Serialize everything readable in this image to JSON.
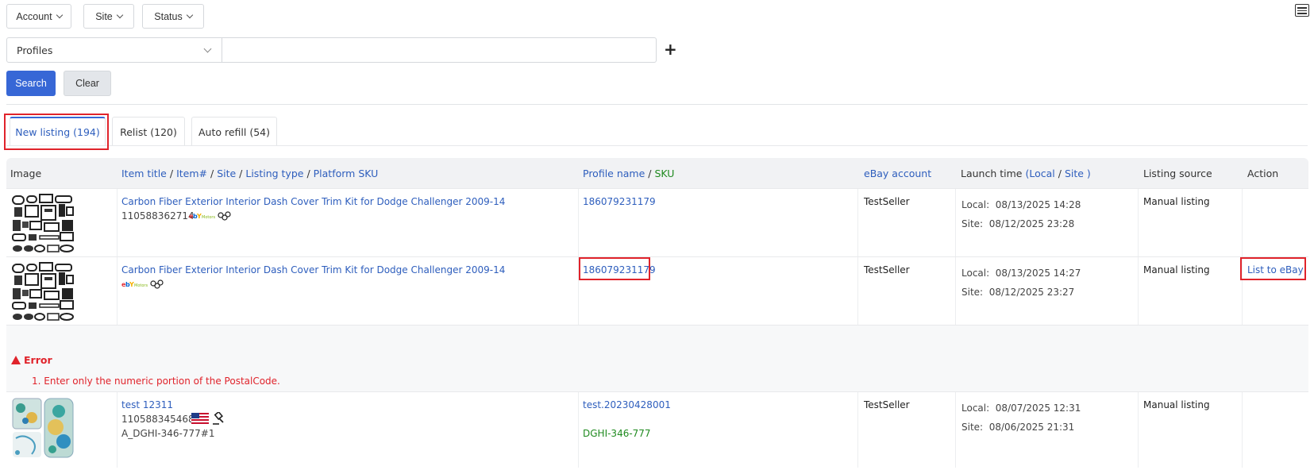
{
  "filters": {
    "account": "Account",
    "site": "Site",
    "status": "Status"
  },
  "search": {
    "profiles_select": "Profiles",
    "input_value": "",
    "input_placeholder": "",
    "plus": "+",
    "search_label": "Search",
    "clear_label": "Clear"
  },
  "tabs": [
    {
      "label": "New listing (194)"
    },
    {
      "label": "Relist (120)"
    },
    {
      "label": "Auto refill (54)"
    }
  ],
  "table": {
    "headers": {
      "image": "Image",
      "item_title": "Item title",
      "item_no": "Item#",
      "site": "Site",
      "listing_type": "Listing type",
      "platform_sku": "Platform SKU",
      "sep": "/",
      "profile_name": "Profile name",
      "sku": "SKU",
      "ebay_account": "eBay account",
      "launch_time": "Launch time",
      "local": "(Local",
      "site_close": "Site )",
      "listing_source": "Listing source",
      "action": "Action"
    },
    "rows": [
      {
        "title": "Carbon Fiber Exterior Interior Dash Cover Trim Kit for Dodge Challenger 2009-14",
        "item_no": "110588362714",
        "profile": "186079231179",
        "sku": "",
        "platform_sku": "",
        "account": "TestSeller",
        "local_label": "Local:",
        "local_time": "08/13/2025 14:28",
        "site_label": "Site:",
        "site_time": "08/12/2025 23:28",
        "source": "Manual listing",
        "action": ""
      },
      {
        "title": "Carbon Fiber Exterior Interior Dash Cover Trim Kit for Dodge Challenger 2009-14",
        "item_no": "",
        "profile": "186079231179",
        "sku": "",
        "platform_sku": "",
        "account": "TestSeller",
        "local_label": "Local:",
        "local_time": "08/13/2025 14:27",
        "site_label": "Site:",
        "site_time": "08/12/2025 23:27",
        "source": "Manual listing",
        "action": "List to eBay"
      },
      {
        "title": "test 12311",
        "item_no": "110588345468",
        "profile": "test.20230428001",
        "sku": "DGHI-346-777",
        "platform_sku": "A_DGHI-346-777#1",
        "account": "TestSeller",
        "local_label": "Local:",
        "local_time": "08/07/2025 12:31",
        "site_label": "Site:",
        "site_time": "08/06/2025 21:31",
        "source": "Manual listing",
        "action": ""
      }
    ],
    "error": {
      "title": "Error",
      "message": "1. Enter only the numeric portion of the PostalCode."
    }
  },
  "colors": {
    "accent": "#3767d6",
    "link": "#2e5ebd",
    "error": "#e0232b",
    "sku_green": "#1f8a1f",
    "highlight_box": "#e0232b"
  },
  "icons": [
    "chevron-down-icon",
    "list-view-icon",
    "plus-icon",
    "warning-triangle-icon",
    "ebay-motors-logo",
    "us-flag-icon",
    "auction-gavel-icon"
  ]
}
